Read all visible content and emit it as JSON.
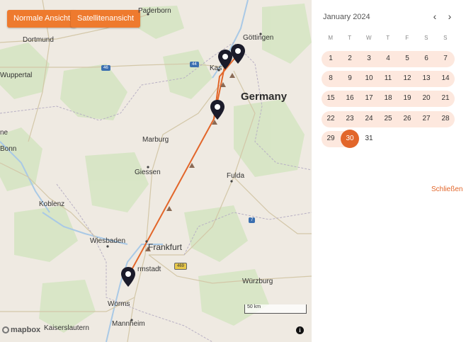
{
  "map": {
    "btn_normal": "Normale Ansicht",
    "btn_satellite": "Satellitenansicht",
    "cities": {
      "paderborn": "Paderborn",
      "dortmund": "Dortmund",
      "goettingen": "Göttingen",
      "wuppertal": "Wuppertal",
      "kassel": "Kas",
      "germany": "Germany",
      "marburg": "Marburg",
      "bonn": "Bonn",
      "giessen": "Giessen",
      "fulda": "Fulda",
      "koblenz": "Koblenz",
      "wiesbaden": "Wiesbaden",
      "frankfurt": "Frankfurt",
      "darmstadt": "rmstadt",
      "wuerzburg": "Würzburg",
      "worms": "Worms",
      "mannheim": "Mannheim",
      "kaiserslautern": "Kaiserslautern",
      "edge_ne": "ne"
    },
    "shields": {
      "a46": "46",
      "a44": "44",
      "a7": "7",
      "a469": "469"
    },
    "scale_label": "50 km",
    "attribution": "mapbox",
    "info_icon": "i",
    "route_color": "#e2662a",
    "pin_color": "#1b1b2a"
  },
  "calendar": {
    "title": "January 2024",
    "prev_icon": "chevron-left-icon",
    "next_icon": "chevron-right-icon",
    "weekdays": [
      "M",
      "T",
      "W",
      "T",
      "F",
      "S",
      "S"
    ],
    "weeks": [
      [
        "1",
        "2",
        "3",
        "4",
        "5",
        "6",
        "7"
      ],
      [
        "8",
        "9",
        "10",
        "11",
        "12",
        "13",
        "14"
      ],
      [
        "15",
        "16",
        "17",
        "18",
        "19",
        "20",
        "21"
      ],
      [
        "22",
        "23",
        "24",
        "25",
        "26",
        "27",
        "28"
      ],
      [
        "29",
        "30",
        "31"
      ]
    ],
    "selected": "30",
    "range_color": "#fde8de",
    "accent": "#e2662a",
    "close_label": "Schließen"
  }
}
